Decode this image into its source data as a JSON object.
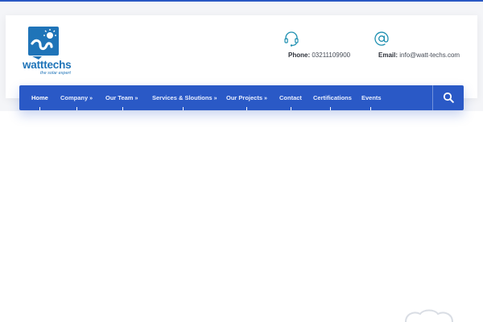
{
  "brand": {
    "name": "watttechs",
    "tagline": "the solar expert",
    "color": "#1f74b8"
  },
  "contacts": [
    {
      "icon": "headset-icon",
      "label": "Phone:",
      "value": "03211109900"
    },
    {
      "icon": "at-sign-icon",
      "label": "Email:",
      "value": "info@watt-techs.com"
    }
  ],
  "nav": {
    "items": [
      {
        "label": "Home",
        "dropdown": false,
        "active": true
      },
      {
        "label": "Company",
        "dropdown": true,
        "active": false
      },
      {
        "label": "Our Team",
        "dropdown": true,
        "active": false
      },
      {
        "label": "Services & Sloutions",
        "dropdown": true,
        "active": false
      },
      {
        "label": "Our Projects",
        "dropdown": true,
        "active": false
      },
      {
        "label": "Contact",
        "dropdown": false,
        "active": false
      },
      {
        "label": "Certifications",
        "dropdown": false,
        "active": false
      },
      {
        "label": "Events",
        "dropdown": false,
        "active": false
      }
    ],
    "dropdown_glyph": "»",
    "search_icon": "search-icon"
  },
  "colors": {
    "accent": "#2a59c6",
    "icon": "#1d8fb0"
  }
}
